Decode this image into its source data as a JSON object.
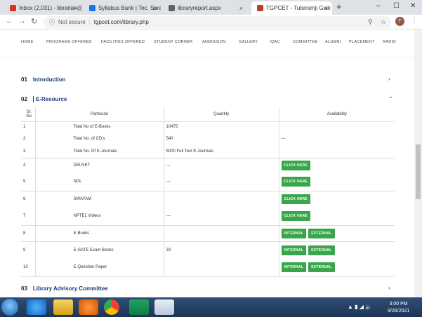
{
  "browser": {
    "tabs": [
      {
        "label": "Inbox (2,031) - librarian@",
        "fav_color": "#d93025"
      },
      {
        "label": "Syllabus Bank | Tec. Saral Sh",
        "fav_color": "#1a73e8"
      },
      {
        "label": "libraryreport.aspx",
        "fav_color": "#5f6368"
      },
      {
        "label": "TGPCET - Tulsiramji Gaik",
        "fav_color": "#c0392b"
      }
    ],
    "new_tab": "+",
    "url_prefix": "Not secure",
    "url": "tgpcet.com/library.php",
    "profile_initial": "T"
  },
  "site_nav": [
    "HOME",
    "PROGRAMS OFFERED",
    "FACILITIES OFFERED",
    "STUDENT CORNER",
    "ADMISSION",
    "GALLERY",
    "IQAC",
    "COMMITTEE",
    "ALUMNI",
    "PLACEMENT",
    "RADIO"
  ],
  "sections": [
    {
      "num": "01",
      "title": "Introduction",
      "chevron": "›"
    },
    {
      "num": "02",
      "title": "E-Resource",
      "chevron": "⌄"
    },
    {
      "num": "03",
      "title": "Library Advisory Committee",
      "chevron": "›"
    }
  ],
  "table": {
    "headers": [
      "Sr. No",
      "Particular",
      "Quantity",
      "Availability"
    ],
    "rows": [
      {
        "sr": "1",
        "particular": "Total No of E-Books",
        "quantity": "10475",
        "buttons": []
      },
      {
        "sr": "2",
        "particular": "Total No. of CD's",
        "quantity": "540",
        "buttons": [],
        "avail_text": "---"
      },
      {
        "sr": "3",
        "particular": "Total No. Of E-Journals",
        "quantity": "5000 Full Text E-Journals",
        "buttons": []
      },
      {
        "sr": "4",
        "particular": "DELNET",
        "quantity": "---",
        "buttons": [
          "CLICK HERE"
        ]
      },
      {
        "sr": "5",
        "particular": "NDL",
        "quantity": "---",
        "buttons": [
          "CLICK HERE"
        ]
      },
      {
        "sr": "6",
        "particular": "SWAYAM",
        "quantity": "",
        "buttons": [
          "CLICK HERE"
        ]
      },
      {
        "sr": "7",
        "particular": "NPTEL Videos",
        "quantity": "---",
        "buttons": [
          "CLICK HERE"
        ]
      },
      {
        "sr": "8",
        "particular": "E-Books",
        "quantity": "",
        "buttons": [
          "INTERNAL",
          "EXTERNAL"
        ]
      },
      {
        "sr": "9",
        "particular": "E-GATE Exam Books",
        "quantity": "33",
        "buttons": [
          "INTERNAL",
          "EXTERNAL"
        ]
      },
      {
        "sr": "10",
        "particular": "E-Question Paper",
        "quantity": "",
        "buttons": [
          "INTERNAL",
          "EXTERNAL"
        ]
      }
    ]
  },
  "taskbar": {
    "time": "3:00 PM",
    "date": "9/26/2021"
  }
}
